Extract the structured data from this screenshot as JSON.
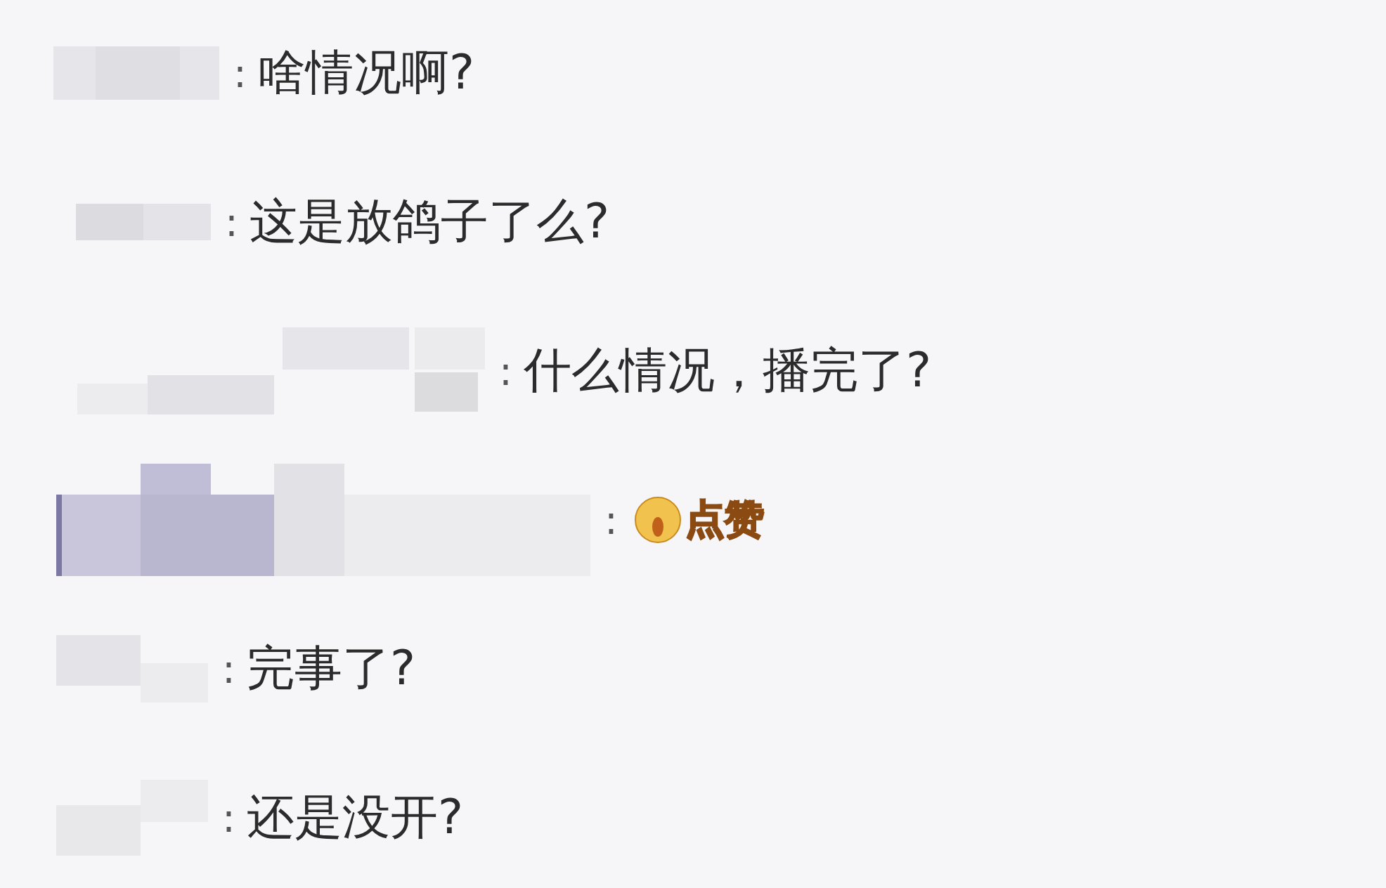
{
  "comments": [
    {
      "kind": "text",
      "colon": ":",
      "message": "啥情况啊?"
    },
    {
      "kind": "text",
      "colon": ":",
      "message": "这是放鸽子了么?"
    },
    {
      "kind": "text",
      "colon": ":",
      "message": "什么情况，播完了?"
    },
    {
      "kind": "sticker",
      "colon": ":",
      "message": "点赞"
    },
    {
      "kind": "text",
      "colon": ":",
      "message": "完事了?"
    },
    {
      "kind": "text",
      "colon": ":",
      "message": "还是没开?"
    }
  ]
}
